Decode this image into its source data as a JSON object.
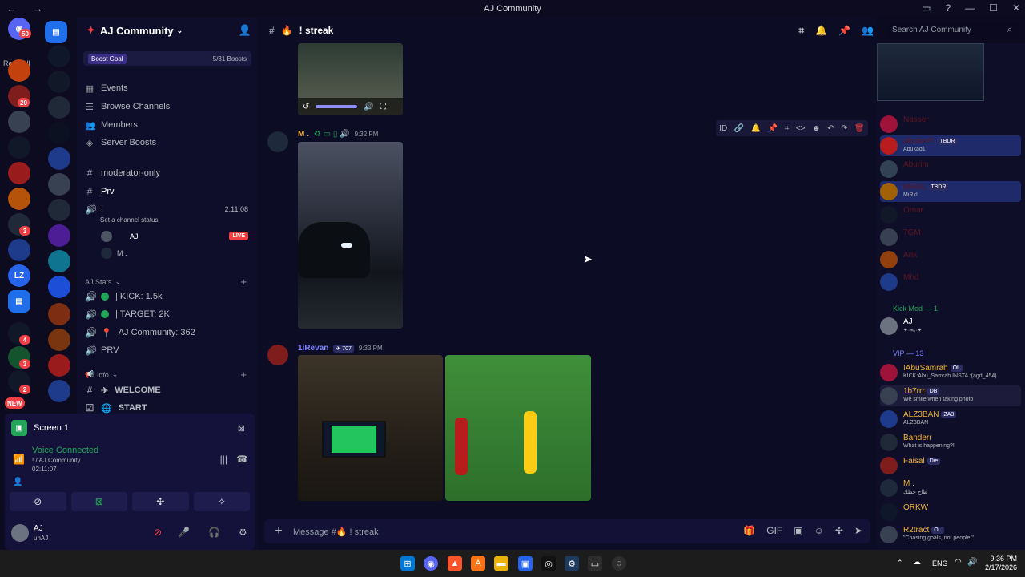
{
  "window": {
    "title": "AJ Community",
    "controls": [
      "▭",
      "?",
      "—",
      "☐",
      "✕"
    ]
  },
  "serverbar": {
    "readall": "Read All",
    "home_badge": "50",
    "badges": [
      "20",
      "3",
      "4",
      "3",
      "2"
    ],
    "new_label": "NEW"
  },
  "guild": {
    "name": "AJ Community",
    "boost_goal": "Boost Goal",
    "boost_count": "5/31 Boosts",
    "nav": [
      "Events",
      "Browse Channels",
      "Members",
      "Server Boosts"
    ],
    "channels_top": [
      "moderator-only",
      "Prv"
    ],
    "voice_channel": {
      "name": "!",
      "timer": "2:11:08",
      "status": "Set a channel status",
      "users": [
        "AJ",
        "M ."
      ],
      "live": "LIVE"
    },
    "category_stats": "AJ Stats",
    "stats_channels": [
      "| KICK: 1.5k",
      "| TARGET: 2K",
      "AJ Community: 362",
      "PRV"
    ],
    "category_info": "info",
    "info_channels": [
      "WELCOME",
      "START"
    ]
  },
  "userpanel": {
    "screen": "Screen 1",
    "voice_connected": "Voice Connected",
    "voice_sub": "! / AJ Community",
    "voice_time": "02:11:07",
    "me_name": "AJ",
    "me_status": "uhAJ"
  },
  "main": {
    "channel_name": "streak",
    "search_placeholder": "Search AJ Community",
    "messages": [
      {
        "author": "M .",
        "time": "9:32 PM"
      },
      {
        "author": "1iRevan",
        "badge": "707",
        "time": "9:33 PM"
      }
    ],
    "composer_placeholder": "Message #🔥 ! streak"
  },
  "members": {
    "categories": [
      "Kick Mod — 1",
      "VIP — 13"
    ],
    "online_top": [
      {
        "name": "Nasser",
        "status": ""
      },
      {
        "name": "Abukad1",
        "tag": "TBDR",
        "status": "Abukad1"
      },
      {
        "name": "Aburim",
        "status": ""
      },
      {
        "name": "MiRkL",
        "tag": "TBDR",
        "status": "MiRkL"
      },
      {
        "name": "Omar",
        "status": ""
      },
      {
        "name": "7GM",
        "status": ""
      },
      {
        "name": "Ank",
        "status": ""
      },
      {
        "name": "Mhd",
        "status": ""
      }
    ],
    "kickmod": [
      {
        "name": "AJ",
        "status": "✦·ᯓ·✦"
      }
    ],
    "vip": [
      {
        "name": "!AbuSamrah",
        "tag": "OL",
        "status": "KICK:Abu_Samrah INSTA :(agd_454)"
      },
      {
        "name": "1b7rrr",
        "tag": "DB",
        "status": "We smile when taking photo"
      },
      {
        "name": "ALZ3BAN",
        "tag": "ZA3",
        "status": "ALZ3BAN"
      },
      {
        "name": "Banderr",
        "status": "What is happening?!"
      },
      {
        "name": "Faisal",
        "tag": "Die",
        "status": ""
      },
      {
        "name": "M .",
        "status": "طاح حظك"
      },
      {
        "name": "ORKW",
        "status": ""
      },
      {
        "name": "R2tract",
        "tag": "OL",
        "status": "\"Chasing goals, not people.\""
      }
    ]
  },
  "taskbar": {
    "lang": "ENG",
    "time": "9:36 PM",
    "date": "2/17/2026"
  },
  "colors": {
    "accent": "#5865f2",
    "live": "#f23f43",
    "online": "#23a55a",
    "vip_name": "#f0b232"
  }
}
